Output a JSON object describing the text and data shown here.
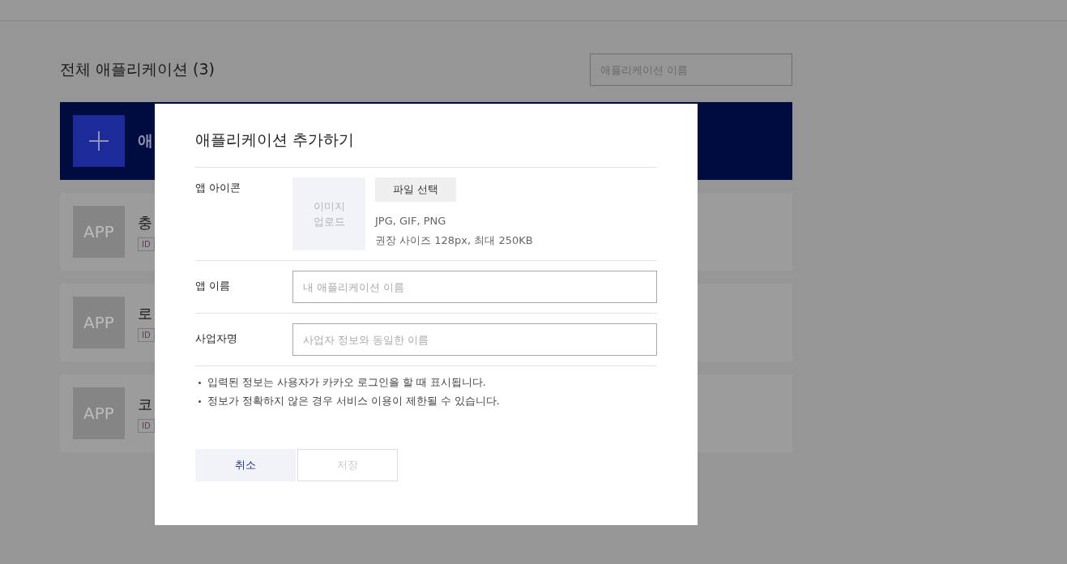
{
  "page": {
    "title": "전체 애플리케이션 (3)",
    "search": {
      "placeholder": "애플리케이션 이름"
    },
    "add_card": {
      "label": "애"
    },
    "apps": [
      {
        "icon_text": "APP",
        "name": "충",
        "tag": "ID"
      },
      {
        "icon_text": "APP",
        "name": "로",
        "tag": "ID"
      },
      {
        "icon_text": "APP",
        "name": "코",
        "tag": "ID"
      }
    ]
  },
  "dialog": {
    "title": "애플리케이션 추가하기",
    "icon_row": {
      "label": "앱 아이콘",
      "upload_box": "이미지\n업로드",
      "file_button": "파일 선택",
      "formats": "JPG, GIF, PNG",
      "size_hint": "권장 사이즈 128px, 최대 250KB"
    },
    "fields": [
      {
        "label": "앱 이름",
        "placeholder": "내 애플리케이션 이름"
      },
      {
        "label": "사업자명",
        "placeholder": "사업자 정보와 동일한 이름"
      }
    ],
    "notes": [
      "입력된 정보는 사용자가 카카오 로그인을 할 때 표시됩니다.",
      "정보가 정확하지 않은 경우 서비스 이용이 제한될 수 있습니다."
    ],
    "buttons": [
      {
        "label": "취소",
        "disabled": false
      },
      {
        "label": "저장",
        "disabled": true
      }
    ]
  }
}
